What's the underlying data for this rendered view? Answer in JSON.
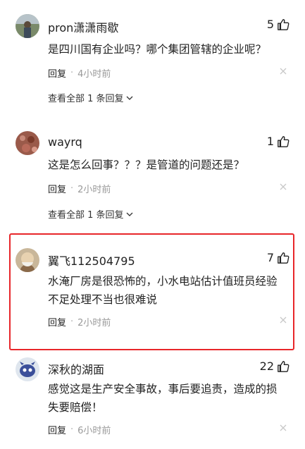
{
  "comments": [
    {
      "username": "pron潇潇雨歇",
      "likes": "5",
      "text": "是四川国有企业吗？哪个集团管辖的企业呢？",
      "reply_label": "回复",
      "separator": "·",
      "time": "4小时前",
      "view_all": "查看全部 1 条回复"
    },
    {
      "username": "wayrq",
      "likes": "1",
      "text": "这是怎么回事？？？是管道的问题还是？",
      "reply_label": "回复",
      "separator": "·",
      "time": "2小时前",
      "view_all": "查看全部 1 条回复"
    },
    {
      "username": "翼飞112504795",
      "likes": "7",
      "text_line1": "水淹厂房是很恐怖的，小水电站估计值班员经验",
      "text_line2": "不足处理不当也很难说",
      "reply_label": "回复",
      "separator": "·",
      "time": "2小时前"
    },
    {
      "username": "深秋的湖面",
      "likes": "22",
      "text_line1": "感觉这是生产安全事故，事后要追责，造成的损",
      "text_line2": "失要赔偿！",
      "reply_label": "回复",
      "separator": "·",
      "time": "6小时前"
    }
  ],
  "colors": {
    "highlight": "#e8262a",
    "time": "#999999"
  }
}
